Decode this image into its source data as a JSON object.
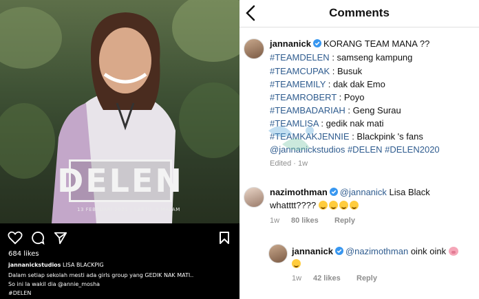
{
  "post": {
    "poster_title": "DELEN",
    "poster_date": "13 FEBRUARI 2021 | SABTU, 9 MALAM",
    "likes": "684 likes",
    "caption_user": "jannanickstudios",
    "caption_line1": "LISA BLACKPIG",
    "caption_line2": "Dalam setiap sekolah mesti ada girls group yang GEDIK NAK MATI..",
    "caption_line3": "So ini la wakil dia @annie_mosha",
    "caption_line4": "#DELEN",
    "icons": [
      "heart-icon",
      "comment-icon",
      "share-icon",
      "bookmark-icon"
    ]
  },
  "header": {
    "title": "Comments",
    "back_icon": "chevron-left-icon"
  },
  "comment1": {
    "user": "jannanick",
    "text": "KORANG TEAM MANA ??",
    "lines": [
      {
        "tag": "#TEAMDELEN",
        "rest": " : samseng kampung"
      },
      {
        "tag": "#TEAMCUPAK",
        "rest": " : Busuk"
      },
      {
        "tag": "#TEAMEMILY",
        "rest": " : dak dak Emo"
      },
      {
        "tag": "#TEAMROBERT",
        "rest": " : Poyo"
      },
      {
        "tag": "#TEAMBADARIAH",
        "rest": " : Geng Surau"
      },
      {
        "tag": "#TEAMLISA",
        "rest": " : gedik nak mati"
      },
      {
        "tag": "#TEAMKAKJENNIE",
        "rest": " : Blackpink 's fans"
      }
    ],
    "last_line_a": "@jannanickstudios",
    "last_line_b": "#DELEN",
    "last_line_c": "#DELEN2020",
    "meta": "Edited · 1w"
  },
  "comment2": {
    "user": "nazimothman",
    "mention": "@jannanick",
    "text1": " Lisa Black",
    "text2": "whatttt????",
    "time": "1w",
    "likes": "80 likes",
    "reply": "Reply"
  },
  "comment3": {
    "user": "jannanick",
    "mention": "@nazimothman",
    "text": " oink oink",
    "time": "1w",
    "likes": "42 likes",
    "reply": "Reply"
  },
  "colors": {
    "hashtag": "#2f5c8f",
    "verified": "#3897f0",
    "meta": "#8e8e8e"
  }
}
